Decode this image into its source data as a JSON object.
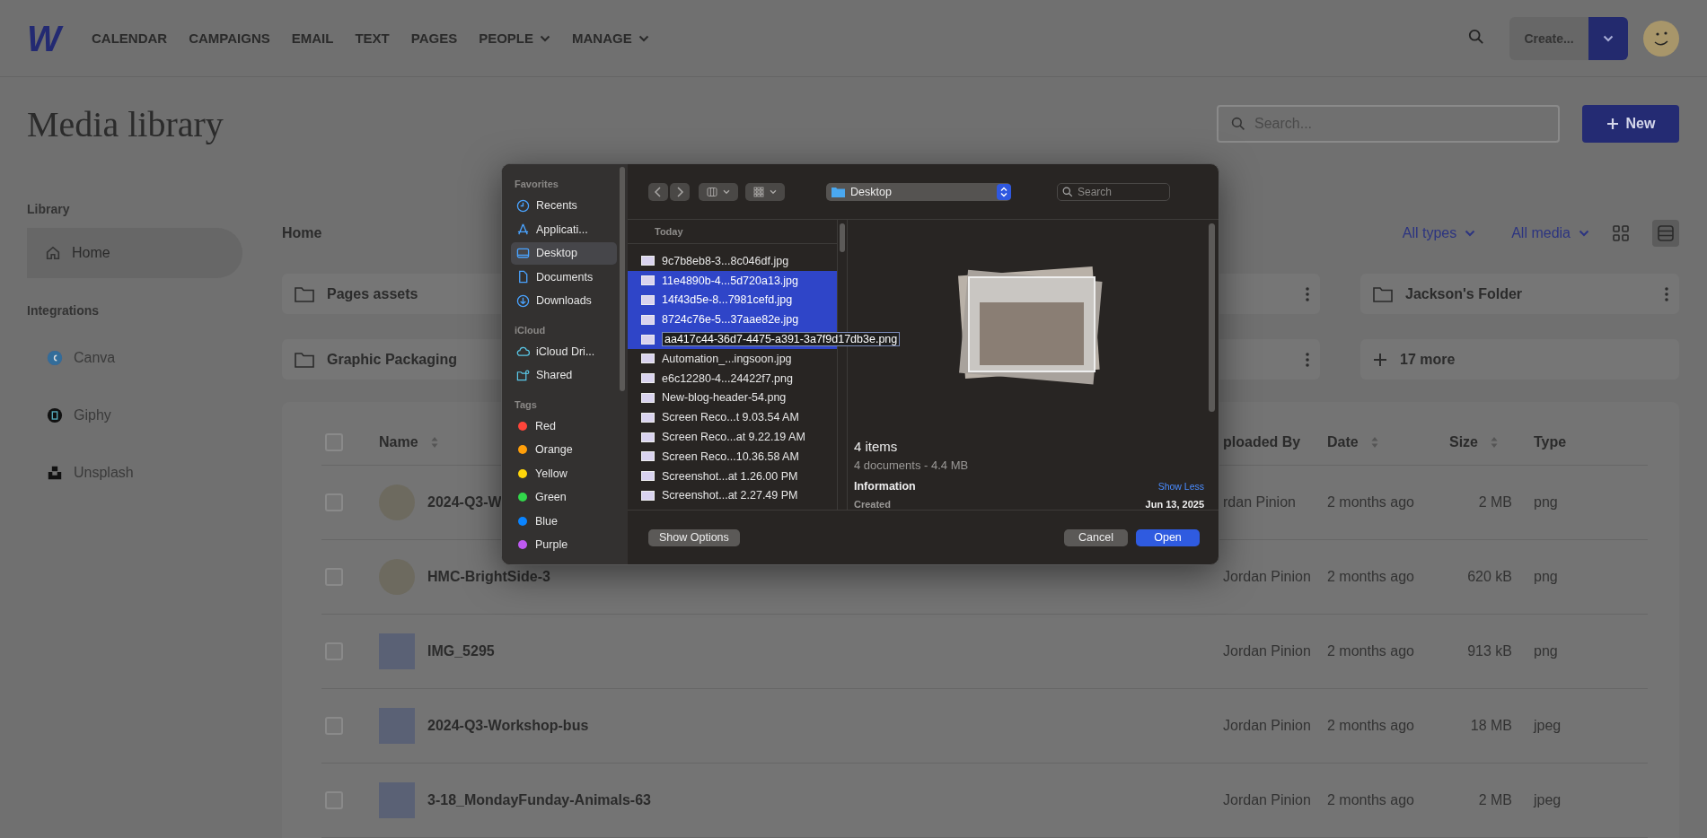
{
  "header": {
    "logo": "W",
    "nav": [
      {
        "label": "CALENDAR",
        "dropdown": false
      },
      {
        "label": "CAMPAIGNS",
        "dropdown": false
      },
      {
        "label": "EMAIL",
        "dropdown": false
      },
      {
        "label": "TEXT",
        "dropdown": false
      },
      {
        "label": "PAGES",
        "dropdown": false
      },
      {
        "label": "PEOPLE",
        "dropdown": true
      },
      {
        "label": "MANAGE",
        "dropdown": true
      }
    ],
    "create_button": "Create..."
  },
  "page": {
    "title": "Media library",
    "search": {
      "placeholder": "Search..."
    },
    "new_button": "New"
  },
  "sidebar": {
    "sections": [
      {
        "heading": "Library",
        "items": [
          {
            "label": "Home",
            "kind": "home",
            "selected": true
          }
        ]
      },
      {
        "heading": "Integrations",
        "items": [
          {
            "label": "Canva",
            "kind": "canva",
            "selected": false
          },
          {
            "label": "Giphy",
            "kind": "giphy",
            "selected": false
          },
          {
            "label": "Unsplash",
            "kind": "unsplash",
            "selected": false
          }
        ]
      }
    ]
  },
  "main": {
    "breadcrumb": "Home",
    "filters": [
      "All types",
      "All media"
    ],
    "view_modes": [
      {
        "kind": "grid",
        "selected": false
      },
      {
        "kind": "list",
        "selected": true
      }
    ],
    "folders": [
      {
        "kind": "folder",
        "name": "Pages assets"
      },
      {
        "kind": "covered"
      },
      {
        "kind": "folder",
        "name": "Jackson's Folder"
      },
      {
        "kind": "folder",
        "name": "Graphic Packaging"
      },
      {
        "kind": "covered"
      },
      {
        "kind": "more",
        "name": "17 more"
      }
    ],
    "table": {
      "select_all": {
        "checked": false
      },
      "columns": [
        {
          "label": "Name",
          "sortable": true
        },
        {
          "label": "ploaded By",
          "sortable": false
        },
        {
          "label": "Date",
          "sortable": true
        },
        {
          "label": "Size",
          "sortable": true
        },
        {
          "label": "Type",
          "sortable": false
        }
      ],
      "rows": [
        {
          "name": "2024-Q3-W",
          "kind": "circle",
          "uploaded_by": "rdan Pinion",
          "date": "2 months ago",
          "size": "2 MB",
          "type": "png",
          "checked": false
        },
        {
          "name": "HMC-BrightSide-3",
          "kind": "circle",
          "uploaded_by": "Jordan Pinion",
          "date": "2 months ago",
          "size": "620 kB",
          "type": "png",
          "checked": false
        },
        {
          "name": "IMG_5295",
          "kind": "square",
          "uploaded_by": "Jordan Pinion",
          "date": "2 months ago",
          "size": "913 kB",
          "type": "png",
          "checked": false
        },
        {
          "name": "2024-Q3-Workshop-bus",
          "kind": "square",
          "uploaded_by": "Jordan Pinion",
          "date": "2 months ago",
          "size": "18 MB",
          "type": "jpeg",
          "checked": false
        },
        {
          "name": "3-18_MondayFunday-Animals-63",
          "kind": "square",
          "uploaded_by": "Jordan Pinion",
          "date": "2 months ago",
          "size": "2 MB",
          "type": "jpeg",
          "checked": false
        }
      ]
    }
  },
  "file_dialog": {
    "sidebar": [
      {
        "heading": "Favorites",
        "items": [
          {
            "label": "Recents",
            "kind": "recents",
            "selected": false
          },
          {
            "label": "Applicati...",
            "kind": "applications",
            "selected": false
          },
          {
            "label": "Desktop",
            "kind": "desktop",
            "selected": true
          },
          {
            "label": "Documents",
            "kind": "documents",
            "selected": false
          },
          {
            "label": "Downloads",
            "kind": "downloads",
            "selected": false
          }
        ]
      },
      {
        "heading": "iCloud",
        "items": [
          {
            "label": "iCloud Dri...",
            "kind": "icloud",
            "selected": false
          },
          {
            "label": "Shared",
            "kind": "shared",
            "selected": false
          }
        ]
      },
      {
        "heading": "Tags",
        "items": [
          {
            "label": "Red",
            "kind": "tag",
            "color": "#ff453a",
            "selected": false
          },
          {
            "label": "Orange",
            "kind": "tag",
            "color": "#ff9f0a",
            "selected": false
          },
          {
            "label": "Yellow",
            "kind": "tag",
            "color": "#ffd60a",
            "selected": false
          },
          {
            "label": "Green",
            "kind": "tag",
            "color": "#32d74b",
            "selected": false
          },
          {
            "label": "Blue",
            "kind": "tag",
            "color": "#0a84ff",
            "selected": false
          },
          {
            "label": "Purple",
            "kind": "tag",
            "color": "#bf5af2",
            "selected": false
          }
        ]
      }
    ],
    "location": "Desktop",
    "search": {
      "placeholder": "Search"
    },
    "list": {
      "heading": "Today",
      "files": [
        {
          "name": "9c7b8eb8-3...8c046df.jpg",
          "selected": false,
          "editing": false
        },
        {
          "name": "11e4890b-4...5d720a13.jpg",
          "selected": true,
          "editing": false
        },
        {
          "name": "14f43d5e-8...7981cefd.jpg",
          "selected": true,
          "editing": false
        },
        {
          "name": "8724c76e-5...37aae82e.jpg",
          "selected": true,
          "editing": false
        },
        {
          "name": "aa417c44-36d7-4475-a391-3a7f9d17db3e.png",
          "selected": true,
          "editing": true
        },
        {
          "name": "Automation_...ingsoon.jpg",
          "selected": false,
          "editing": false
        },
        {
          "name": "e6c12280-4...24422f7.png",
          "selected": false,
          "editing": false
        },
        {
          "name": "New-blog-header-54.png",
          "selected": false,
          "editing": false
        },
        {
          "name": "Screen Reco...t 9.03.54 AM",
          "selected": false,
          "editing": false
        },
        {
          "name": "Screen Reco...at 9.22.19 AM",
          "selected": false,
          "editing": false
        },
        {
          "name": "Screen Reco...10.36.58 AM",
          "selected": false,
          "editing": false
        },
        {
          "name": "Screenshot...at 1.26.00 PM",
          "selected": false,
          "editing": false
        },
        {
          "name": "Screenshot...at 2.27.49 PM",
          "selected": false,
          "editing": false
        }
      ]
    },
    "preview": {
      "title": "4 items",
      "subtitle": "4 documents - 4.4 MB",
      "info_heading": "Information",
      "toggle": "Show Less",
      "fields": [
        {
          "label": "Created",
          "value": "Jun 13, 2025"
        }
      ]
    },
    "buttons": [
      {
        "label": "Show Options",
        "kind": "secondary"
      },
      {
        "label": "Cancel",
        "kind": "secondary"
      },
      {
        "label": "Open",
        "kind": "primary"
      }
    ]
  }
}
